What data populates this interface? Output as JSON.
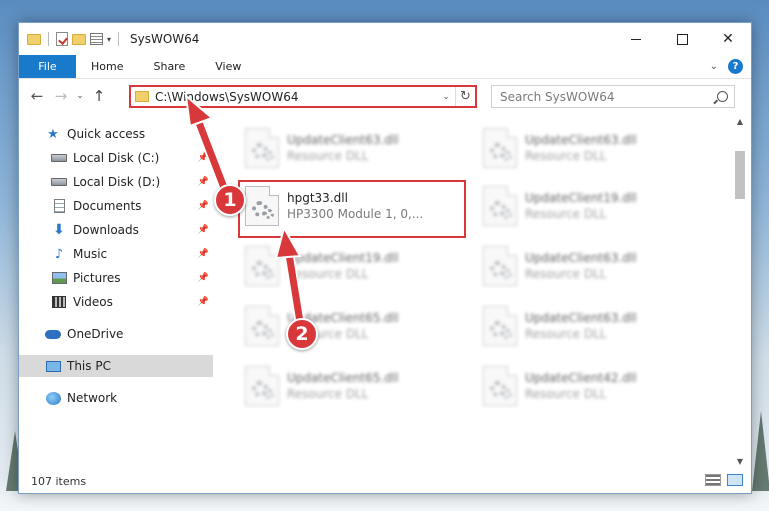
{
  "window": {
    "title": "SysWOW64",
    "close_glyph": "✕"
  },
  "ribbon": {
    "tabs": [
      {
        "label": "File"
      },
      {
        "label": "Home"
      },
      {
        "label": "Share"
      },
      {
        "label": "View"
      }
    ],
    "help_glyph": "?",
    "collapse_glyph": "⌄"
  },
  "navigation": {
    "back_glyph": "←",
    "forward_glyph": "→",
    "recent_glyph": "⌄",
    "up_glyph": "↑",
    "address": "C:\\Windows\\SysWOW64",
    "address_dropdown_glyph": "⌄",
    "refresh_glyph": "↻",
    "search_placeholder": "Search SysWOW64"
  },
  "sidebar": {
    "pin_glyph": "📌",
    "items": [
      {
        "label": "Quick access",
        "icon": "star-icon",
        "glyph": "★"
      },
      {
        "label": "Local Disk (C:)",
        "icon": "disk-icon",
        "pinned": true
      },
      {
        "label": "Local Disk (D:)",
        "icon": "disk-icon",
        "pinned": true
      },
      {
        "label": "Documents",
        "icon": "documents-icon",
        "pinned": true
      },
      {
        "label": "Downloads",
        "icon": "download-icon",
        "glyph": "⬇",
        "pinned": true
      },
      {
        "label": "Music",
        "icon": "music-icon",
        "glyph": "♪",
        "pinned": true
      },
      {
        "label": "Pictures",
        "icon": "pictures-icon",
        "pinned": true
      },
      {
        "label": "Videos",
        "icon": "videos-icon",
        "pinned": true
      },
      {
        "label": "OneDrive",
        "icon": "onedrive-icon"
      },
      {
        "label": "This PC",
        "icon": "this-pc-icon",
        "selected": true
      },
      {
        "label": "Network",
        "icon": "network-icon"
      }
    ]
  },
  "files": [
    {
      "name": "UpdateClient63.dll",
      "desc": "Resource DLL",
      "blurred": true
    },
    {
      "name": "UpdateClient63.dll",
      "desc": "Resource DLL",
      "blurred": true
    },
    {
      "name": "hpgt33.dll",
      "desc": "HP3300 Module 1, 0,...",
      "blurred": false,
      "highlighted": true
    },
    {
      "name": "UpdateClient19.dll",
      "desc": "Resource DLL",
      "blurred": true
    },
    {
      "name": "UpdateClient19.dll",
      "desc": "Resource DLL",
      "blurred": true
    },
    {
      "name": "UpdateClient63.dll",
      "desc": "Resource DLL",
      "blurred": true
    },
    {
      "name": "UpdateClient65.dll",
      "desc": "Resource DLL",
      "blurred": true
    },
    {
      "name": "UpdateClient63.dll",
      "desc": "Resource DLL",
      "blurred": true
    },
    {
      "name": "UpdateClient65.dll",
      "desc": "Resource DLL",
      "blurred": true
    },
    {
      "name": "UpdateClient42.dll",
      "desc": "Resource DLL",
      "blurred": true
    }
  ],
  "status": {
    "item_count": "107 items"
  },
  "annotations": {
    "color": "#d9383a",
    "steps": [
      {
        "number": "1"
      },
      {
        "number": "2"
      }
    ]
  },
  "colors": {
    "accent": "#1979ca",
    "highlight": "#d9383a"
  }
}
